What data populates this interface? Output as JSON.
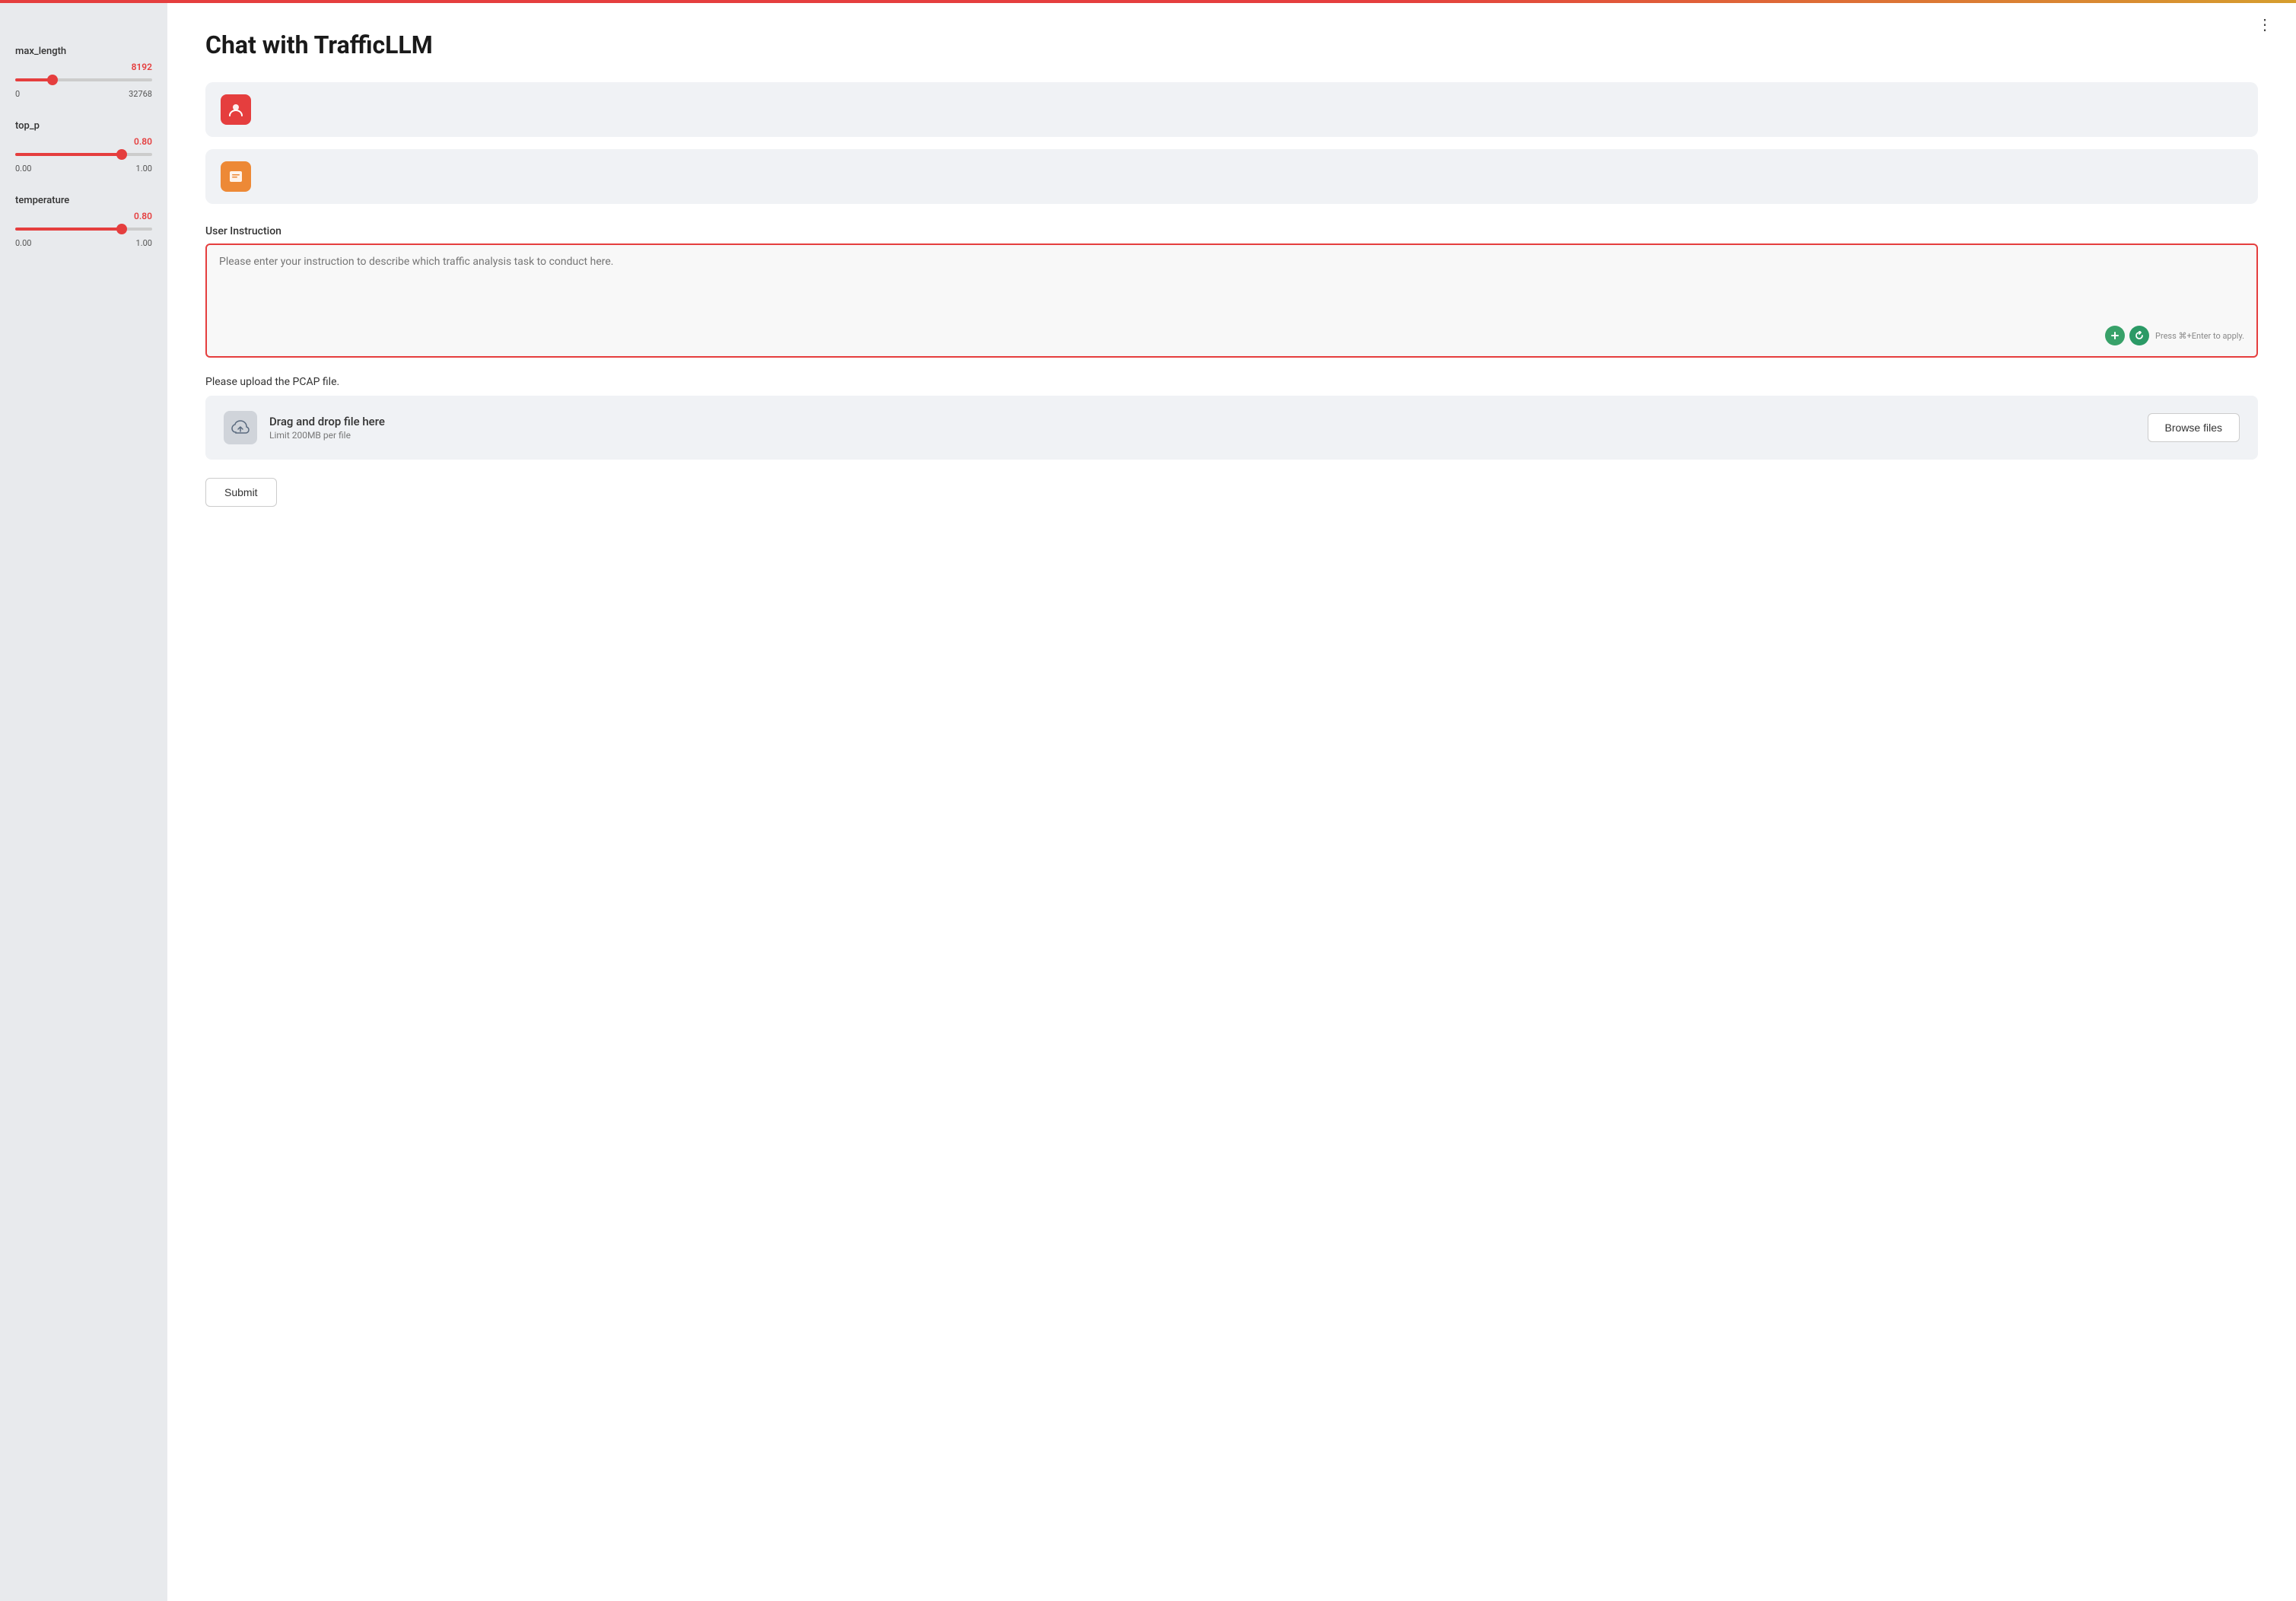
{
  "topbar": {
    "color_left": "#e53e3e",
    "color_right": "#d69e2e"
  },
  "sidebar": {
    "params": [
      {
        "id": "max_length",
        "label": "max_length",
        "value": 8192,
        "value_display": "8192",
        "min": 0,
        "max": 32768,
        "min_label": "0",
        "max_label": "32768",
        "pct": 25
      },
      {
        "id": "top_p",
        "label": "top_p",
        "value": 0.8,
        "value_display": "0.80",
        "min": 0.0,
        "max": 1.0,
        "min_label": "0.00",
        "max_label": "1.00",
        "pct": 80
      },
      {
        "id": "temperature",
        "label": "temperature",
        "value": 0.8,
        "value_display": "0.80",
        "min": 0.0,
        "max": 1.0,
        "min_label": "0.00",
        "max_label": "1.00",
        "pct": 80
      }
    ]
  },
  "main": {
    "title": "Chat with TrafficLLM",
    "more_menu_label": "⋮",
    "chat_bubbles": [
      {
        "id": "bubble-1",
        "avatar_type": "red",
        "avatar_icon": "😊"
      },
      {
        "id": "bubble-2",
        "avatar_type": "orange",
        "avatar_icon": "🗂"
      }
    ],
    "user_instruction": {
      "label": "User Instruction",
      "placeholder": "Please enter your instruction to describe which traffic analysis task to conduct here.",
      "shortcut_hint": "Press ⌘+Enter to apply."
    },
    "upload": {
      "label": "Please upload the PCAP file.",
      "drag_drop_text": "Drag and drop file here",
      "limit_text": "Limit 200MB per file",
      "browse_label": "Browse files"
    },
    "submit_label": "Submit"
  }
}
